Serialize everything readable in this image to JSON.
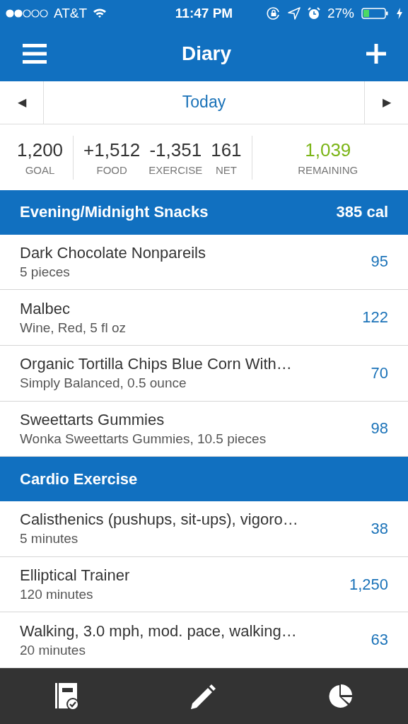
{
  "status_bar": {
    "carrier": "AT&T",
    "time": "11:47 PM",
    "battery": "27%"
  },
  "nav": {
    "title": "Diary"
  },
  "date_bar": {
    "prev": "◀",
    "label": "Today",
    "next": "▶"
  },
  "summary": {
    "groups": [
      {
        "items": [
          {
            "value": "1,200",
            "label": "GOAL",
            "highlight": false
          }
        ]
      },
      {
        "items": [
          {
            "value": "+1,512",
            "label": "FOOD",
            "highlight": false
          },
          {
            "value": "-1,351",
            "label": "EXERCISE",
            "highlight": false
          },
          {
            "value": "161",
            "label": "NET",
            "highlight": false
          }
        ]
      },
      {
        "items": [
          {
            "value": "1,039",
            "label": "REMAINING",
            "highlight": true
          }
        ]
      }
    ]
  },
  "sections": [
    {
      "title": "Evening/Midnight Snacks",
      "total": "385 cal",
      "entries": [
        {
          "name": "Dark Chocolate Nonpareils",
          "detail": "5 pieces",
          "value": "95"
        },
        {
          "name": "Malbec",
          "detail": "Wine, Red, 5 fl oz",
          "value": "122"
        },
        {
          "name": "Organic Tortilla Chips Blue Corn With…",
          "detail": "Simply Balanced, 0.5 ounce",
          "value": "70"
        },
        {
          "name": "Sweettarts Gummies",
          "detail": "Wonka Sweettarts Gummies, 10.5 pieces",
          "value": "98"
        }
      ]
    },
    {
      "title": "Cardio Exercise",
      "entries": [
        {
          "name": "Calisthenics (pushups, sit-ups), vigoro…",
          "detail": "5 minutes",
          "value": "38"
        },
        {
          "name": "Elliptical Trainer",
          "detail": "120 minutes",
          "value": "1,250"
        },
        {
          "name": "Walking, 3.0 mph, mod. pace, walking…",
          "detail": "20 minutes",
          "value": "63"
        }
      ]
    }
  ],
  "tab_bar": [
    {
      "kind": "diary",
      "selected": false
    },
    {
      "kind": "edit",
      "selected": false
    },
    {
      "kind": "chart",
      "selected": false
    }
  ]
}
